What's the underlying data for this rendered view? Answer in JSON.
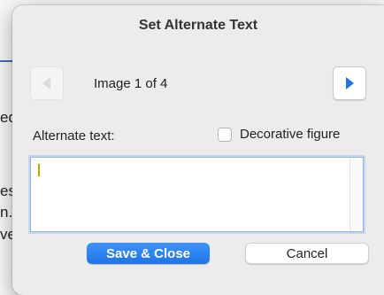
{
  "background_document": {
    "fragments": [
      "ed",
      "es",
      "n.",
      "ve"
    ]
  },
  "dialog": {
    "title": "Set Alternate Text",
    "navigation": {
      "prev_icon": "triangle-left-icon",
      "next_icon": "triangle-right-icon",
      "counter_text": "Image 1 of 4",
      "prev_enabled": false,
      "next_enabled": true
    },
    "alt_text": {
      "label": "Alternate text:",
      "value": ""
    },
    "decorative": {
      "label": "Decorative figure",
      "checked": false
    },
    "buttons": {
      "save_label": "Save & Close",
      "cancel_label": "Cancel"
    }
  },
  "colors": {
    "accent": "#1f74e8",
    "caret": "#c8a400",
    "next_arrow": "#1f74e8",
    "prev_arrow_disabled": "#dcdcdc"
  }
}
